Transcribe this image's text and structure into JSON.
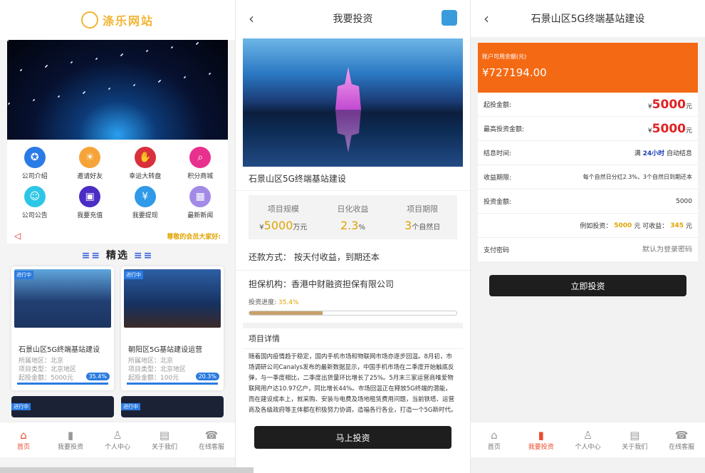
{
  "s1": {
    "logo": "涤乐网站",
    "grid": [
      {
        "label": "公司介绍",
        "icon": "medal-icon",
        "color": "#2a7be6",
        "glyph": "✪"
      },
      {
        "label": "邀请好友",
        "icon": "bulb-icon",
        "color": "#f6a43a",
        "glyph": "☀"
      },
      {
        "label": "幸运大转盘",
        "icon": "handshake-icon",
        "color": "#d9303c",
        "glyph": "✋"
      },
      {
        "label": "积分商城",
        "icon": "search-icon",
        "color": "#e8308e",
        "glyph": "⌕"
      },
      {
        "label": "公司公告",
        "icon": "android-icon",
        "color": "#2ec6e6",
        "glyph": "☺"
      },
      {
        "label": "我要充值",
        "icon": "wallet-icon",
        "color": "#4b2cc4",
        "glyph": "▣"
      },
      {
        "label": "我要提现",
        "icon": "yen-icon",
        "color": "#2f9ae8",
        "glyph": "¥"
      },
      {
        "label": "最新新闻",
        "icon": "grid-icon",
        "color": "#a28be6",
        "glyph": "▦"
      }
    ],
    "notice": "尊敬的会员大家好:",
    "section": "精选",
    "cards": [
      {
        "tag": "进行中",
        "title": "石景山区5G终端基站建设",
        "region": "所属地区：北京",
        "type": "项目类型：北京地区",
        "min": "起投金额：5000元",
        "pct": "35.4%",
        "bg": "linear-gradient(180deg,#5fa6dd,#223f73 55%,#1b3560)"
      },
      {
        "tag": "进行中",
        "title": "朝阳区5G基站建设运营",
        "region": "所属地区：北京",
        "type": "项目类型：北京地区",
        "min": "起投金额：100元",
        "pct": "20.3%",
        "bg": "linear-gradient(180deg,#2d5fa5,#16315f 60%,#3a2a28)"
      }
    ],
    "peek_tags": [
      "进行中",
      "进行中"
    ],
    "tabs": [
      {
        "label": "首页",
        "glyph": "⌂",
        "on": true
      },
      {
        "label": "我要投资",
        "glyph": "▮",
        "on": false
      },
      {
        "label": "个人中心",
        "glyph": "♙",
        "on": false
      },
      {
        "label": "关于我们",
        "glyph": "▤",
        "on": false
      },
      {
        "label": "在线客服",
        "glyph": "☎",
        "on": false
      }
    ]
  },
  "s2": {
    "title": "我要投资",
    "project": "石景山区5G终端基站建设",
    "stats": [
      {
        "label": "项目规模",
        "pre": "¥",
        "value": "5000",
        "unit": "万元"
      },
      {
        "label": "日化收益",
        "pre": "",
        "value": "2.3",
        "unit": "%"
      },
      {
        "label": "项目期限",
        "pre": "",
        "value": "3",
        "unit": "个自然日"
      }
    ],
    "repay": "还款方式：  按天付收益，到期还本",
    "guarantee": "担保机构：香港中财融资担保有限公司",
    "progress_label": "投资进度:",
    "progress_value": "35.4%",
    "progress": 0.354,
    "detail_title": "项目详情",
    "detail_text": "随着国内疫情趋于稳定，国内手机市场和物联网市场亦逐步回温。8月初，市场调研公司Canalys发布的最新数据显示，中国手机市场在二季度开始触底反弹，与一季度相比，二季度出货量环比增长了25%。5月末三家运营商唯爱物联网用户达10.97亿户，同比增长44%。市场回温正在释放5G终端的潜能，而在建设成本上，就采购、安装与电费及场地租赁费用问题，当前铁塔、运营商及各级政府等主体都在积极努力协调，造福各行各业，打造一个5G新时代。",
    "button": "马上投资"
  },
  "s3": {
    "title": "石景山区5G终端基站建设",
    "balance_label": "账户可用余额(元)",
    "balance": "¥727194.00",
    "rows": [
      {
        "label": "起投金额:",
        "pre": "¥",
        "value": "5000",
        "unit": "元",
        "style": "red"
      },
      {
        "label": "最高投资金额:",
        "pre": "¥",
        "value": "5000",
        "unit": "元",
        "style": "red"
      },
      {
        "label": "结息时间:",
        "pre": "满 ",
        "value": "24小时",
        "unit": " 自动结息",
        "style": "blue"
      },
      {
        "label": "收益期限:",
        "pre": "",
        "value": "每个自然日分红2.3%，3个自然日到期还本",
        "unit": "",
        "style": ""
      },
      {
        "label": "投资金额:",
        "pre": "",
        "value": "5000",
        "unit": "",
        "style": ""
      }
    ],
    "example_pre": "例如投资：",
    "example_amt": "5000",
    "example_mid": "元 可收益：",
    "example_gain": "345",
    "example_unit": "元",
    "pwd_label": "支付密码",
    "pwd_placeholder": "默认为登录密码",
    "button": "立即投资",
    "tabs": [
      {
        "label": "首页",
        "glyph": "⌂",
        "on": false
      },
      {
        "label": "我要投资",
        "glyph": "▮",
        "on": true
      },
      {
        "label": "个人中心",
        "glyph": "♙",
        "on": false
      },
      {
        "label": "关于我们",
        "glyph": "▤",
        "on": false
      },
      {
        "label": "在线客服",
        "glyph": "☎",
        "on": false
      }
    ]
  }
}
